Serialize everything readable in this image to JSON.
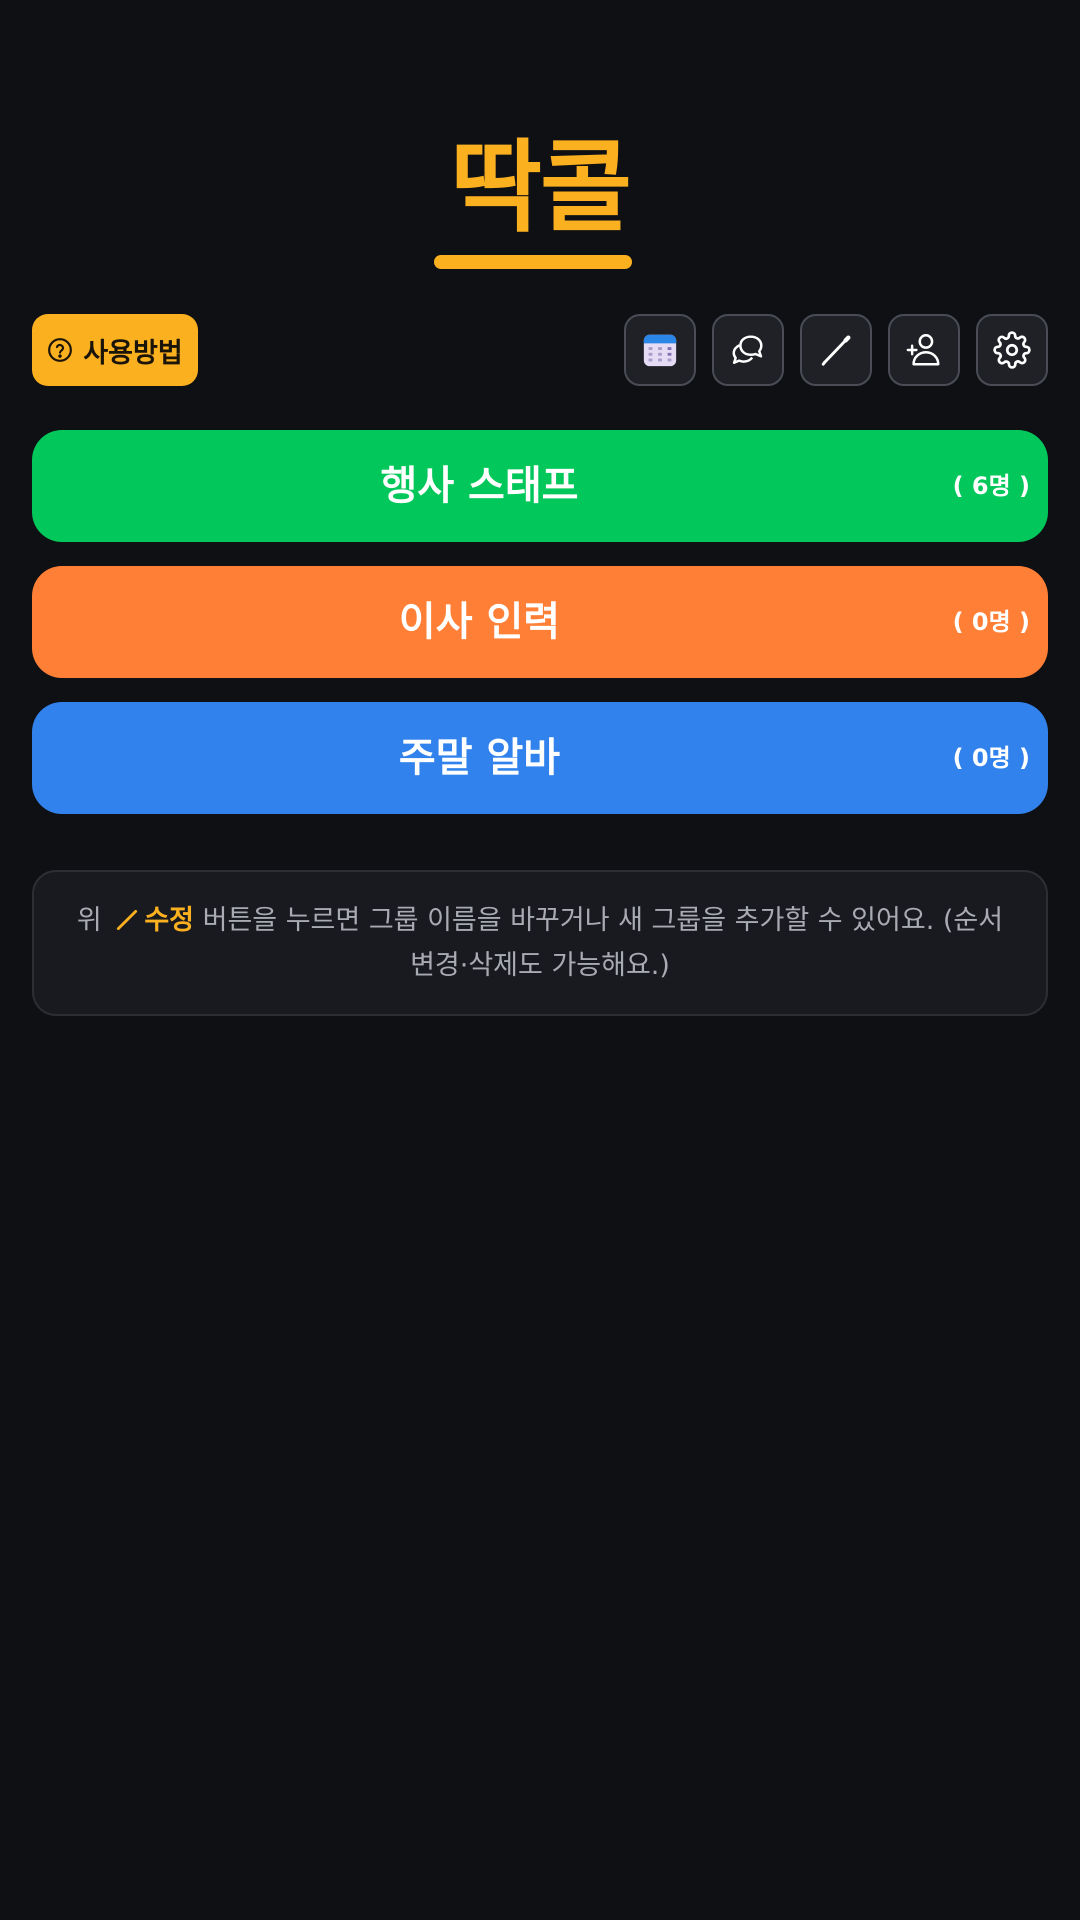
{
  "app": {
    "title": "딱콜",
    "accent_color": "#fbb020"
  },
  "toolbar": {
    "help_label": "사용방법",
    "help_icon": "question-circle-icon",
    "icons": [
      {
        "name": "calendar-icon"
      },
      {
        "name": "chat-bubble-icon"
      },
      {
        "name": "pencil-icon"
      },
      {
        "name": "add-person-icon"
      },
      {
        "name": "gear-icon"
      }
    ]
  },
  "groups": [
    {
      "name": "행사 스태프",
      "count": "( 6명 )",
      "color": "#02c75a"
    },
    {
      "name": "이사 인력",
      "count": "( 0명 )",
      "color": "#ff7f36"
    },
    {
      "name": "주말 알바",
      "count": "( 0명 )",
      "color": "#3182ec"
    }
  ],
  "notice": {
    "prefix": "위",
    "highlight": "수정",
    "text_line1": " 버튼을 누르면 그룹 이름을 바꾸거나 새 그룹을 추가할 수 있어요. (순서",
    "text_line2": "변경·삭제도 가능해요.)"
  }
}
